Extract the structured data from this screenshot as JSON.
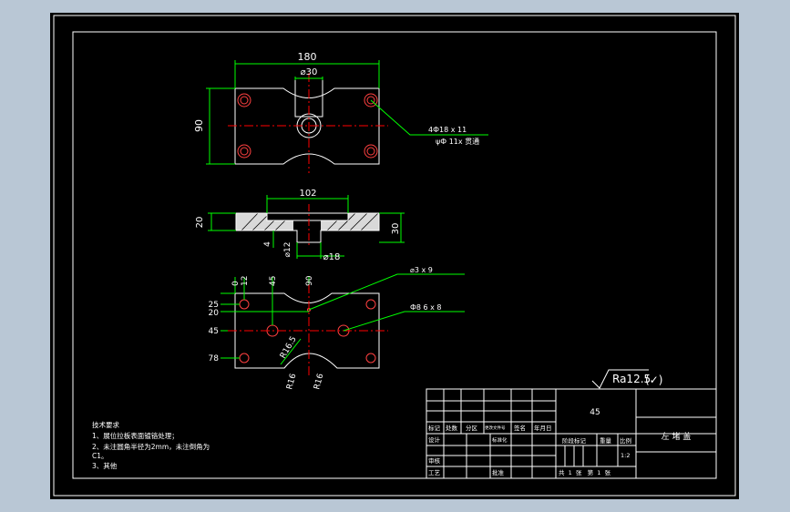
{
  "colors": {
    "window_bg": "#b9c7d5",
    "canvas": "#000000",
    "frame": "#ffffff",
    "outline": "#ffffff",
    "dimension": "#00ff00",
    "centerline": "#ff0000",
    "hole": "#ff4040",
    "text": "#ffffff",
    "table_line": "#ffffff"
  },
  "top_view": {
    "dim_width": "180",
    "dim_slot": "⌀30",
    "dim_height": "90",
    "callout_line1": "4Ф18 x 11",
    "callout_line2": "ψФ 11x 贯通"
  },
  "section_view": {
    "dim_inner": "102",
    "dim_left": "20",
    "dim_right": "30",
    "dim_step": "4",
    "dim_bore_small": "⌀12",
    "dim_bore_large": "⌀18"
  },
  "bottom_view": {
    "dim_x0": "0",
    "dim_x12": "12",
    "dim_x45": "45",
    "dim_x90": "90",
    "dim_y25": "25",
    "dim_y20": "20",
    "dim_y45": "45",
    "dim_y78": "78",
    "dim_r_a": "R16.5",
    "dim_r_b": "R16",
    "dim_r_c": "R16",
    "callout_a": "⌀3 x 9",
    "callout_b": "Ф8 6 x 8"
  },
  "roughness": {
    "value": "Ra12.5",
    "check": "(✓)"
  },
  "tech_notes": {
    "title": "技术要求",
    "line1": "1、展位拉板表面镀铬处理；",
    "line2": "2、未注圆角半径为2mm，未注倒角为",
    "line3": "C1。",
    "line4": "3、其他"
  },
  "title_block": {
    "material": "45",
    "part_name": "左 堵 盖",
    "label_mark": "标记",
    "label_count": "处数",
    "label_zone": "分区",
    "label_change_doc": "更改文件号",
    "label_sign": "签名",
    "label_date": "年月日",
    "label_design": "设计",
    "label_standardize": "标准化",
    "label_stage_mark": "阶段标记",
    "label_weight": "重量",
    "label_scale": "比例",
    "scale_value": "1:2",
    "label_review": "审核",
    "label_process": "工艺",
    "label_approve": "批准",
    "sheet_info": "共  1  张   第  1  张"
  }
}
